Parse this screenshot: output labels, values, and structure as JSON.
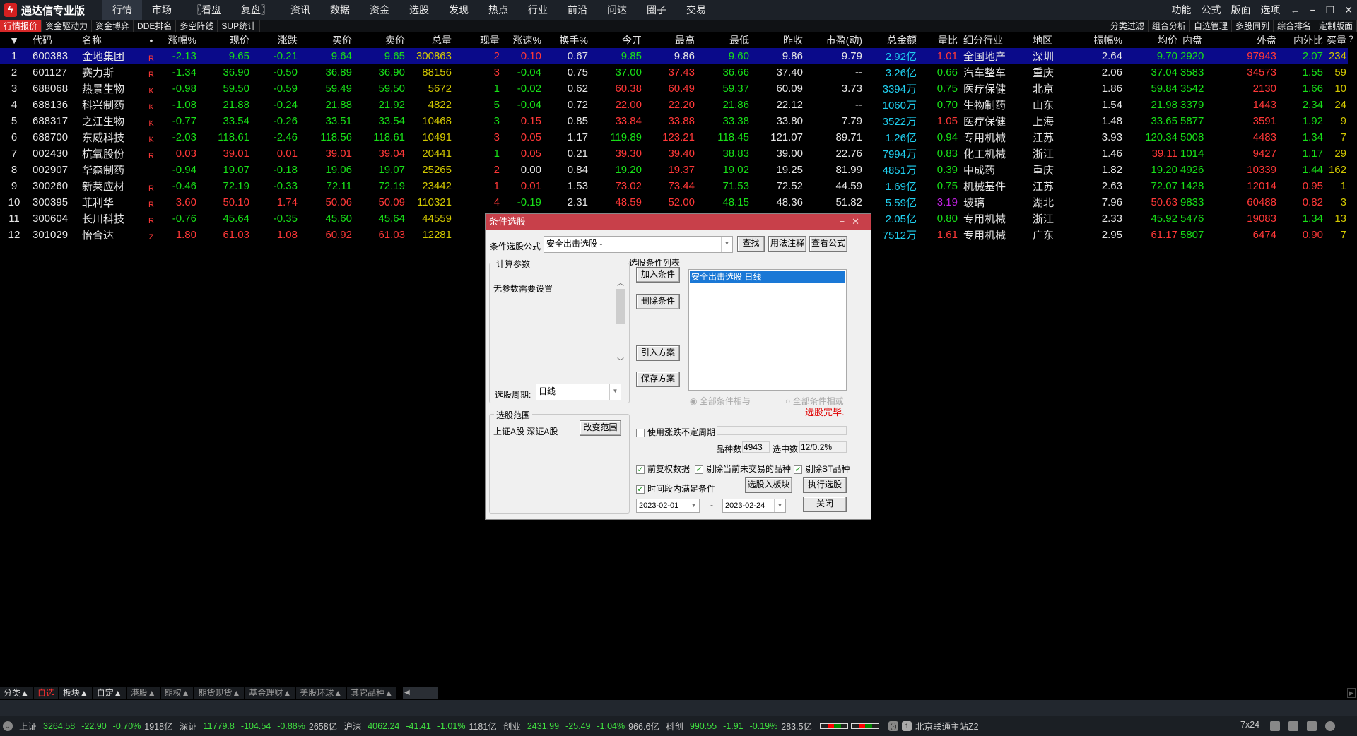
{
  "app": {
    "title": "通达信专业版"
  },
  "menu": [
    "行情",
    "市场",
    "〖看盘",
    "复盘〗",
    "资讯",
    "数据",
    "资金",
    "选股",
    "发现",
    "热点",
    "行业",
    "前沿",
    "问达",
    "圈子",
    "交易"
  ],
  "topright": [
    "功能",
    "公式",
    "版面",
    "选项"
  ],
  "subtabs": [
    "行情报价",
    "资金驱动力",
    "资金博弈",
    "DDE排名",
    "多空阵线",
    "SUP统计"
  ],
  "subtabs_right": [
    "分类过滤",
    "组合分析",
    "自选管理",
    "多股同列",
    "综合排名",
    "定制版面"
  ],
  "headers": [
    "▼",
    "代码",
    "名称",
    "•",
    "涨幅%",
    "现价",
    "涨跌",
    "买价",
    "卖价",
    "总量",
    "现量",
    "涨速%",
    "换手%",
    "今开",
    "最高",
    "最低",
    "昨收",
    "市盈(动)",
    "总金额",
    "量比",
    "细分行业",
    "地区",
    "振幅%",
    "均价",
    "内盘",
    "外盘",
    "内外比",
    "买量",
    "?"
  ],
  "rows": [
    {
      "v": [
        "1",
        "600383",
        "金地集团",
        "R",
        "-2.13",
        "9.65",
        "-0.21",
        "9.64",
        "9.65",
        "300863",
        "2",
        "0.10",
        "0.67",
        "9.85",
        "9.86",
        "9.60",
        "9.86",
        "9.79",
        "2.92亿",
        "1.01",
        "全国地产",
        "深圳",
        "2.64",
        "9.70",
        "2920",
        "97943",
        "2.07",
        "234"
      ],
      "c": "wwwrgggggyrrwgwgwwcrwwwggrgy"
    },
    {
      "v": [
        "2",
        "601127",
        "赛力斯",
        "R",
        "-1.34",
        "36.90",
        "-0.50",
        "36.89",
        "36.90",
        "88156",
        "3",
        "-0.04",
        "0.75",
        "37.00",
        "37.43",
        "36.66",
        "37.40",
        "--",
        "3.26亿",
        "0.66",
        "汽车整车",
        "重庆",
        "2.06",
        "37.04",
        "3583",
        "34573",
        "1.55",
        "59"
      ],
      "c": "wwwrgggggyrgwgrgwwcgwwwggrgy"
    },
    {
      "v": [
        "3",
        "688068",
        "热景生物",
        "K",
        "-0.98",
        "59.50",
        "-0.59",
        "59.49",
        "59.50",
        "5672",
        "1",
        "-0.02",
        "0.62",
        "60.38",
        "60.49",
        "59.37",
        "60.09",
        "3.73",
        "3394万",
        "0.75",
        "医疗保健",
        "北京",
        "1.86",
        "59.84",
        "3542",
        "2130",
        "1.66",
        "10"
      ],
      "c": "wwwrgggggyggwrrgwwcgwwwggrgy"
    },
    {
      "v": [
        "4",
        "688136",
        "科兴制药",
        "K",
        "-1.08",
        "21.88",
        "-0.24",
        "21.88",
        "21.92",
        "4822",
        "5",
        "-0.04",
        "0.72",
        "22.00",
        "22.20",
        "21.86",
        "22.12",
        "--",
        "1060万",
        "0.70",
        "生物制药",
        "山东",
        "1.54",
        "21.98",
        "3379",
        "1443",
        "2.34",
        "24"
      ],
      "c": "wwwrgggggyggwrrgwwcgwwwggrgy"
    },
    {
      "v": [
        "5",
        "688317",
        "之江生物",
        "K",
        "-0.77",
        "33.54",
        "-0.26",
        "33.51",
        "33.54",
        "10468",
        "3",
        "0.15",
        "0.85",
        "33.84",
        "33.88",
        "33.38",
        "33.80",
        "7.79",
        "3522万",
        "1.05",
        "医疗保健",
        "上海",
        "1.48",
        "33.65",
        "5877",
        "3591",
        "1.92",
        "9"
      ],
      "c": "wwwrgggggygrwrrgwwcrwwwggrgy"
    },
    {
      "v": [
        "6",
        "688700",
        "东威科技",
        "K",
        "-2.03",
        "118.61",
        "-2.46",
        "118.56",
        "118.61",
        "10491",
        "3",
        "0.05",
        "1.17",
        "119.89",
        "123.21",
        "118.45",
        "121.07",
        "89.71",
        "1.26亿",
        "0.94",
        "专用机械",
        "江苏",
        "3.93",
        "120.34",
        "5008",
        "4483",
        "1.34",
        "7"
      ],
      "c": "wwwrgggggyrrwgrgwwcgwwwggrgy"
    },
    {
      "v": [
        "7",
        "002430",
        "杭氧股份",
        "R",
        "0.03",
        "39.01",
        "0.01",
        "39.01",
        "39.04",
        "20441",
        "1",
        "0.05",
        "0.21",
        "39.30",
        "39.40",
        "38.83",
        "39.00",
        "22.76",
        "7994万",
        "0.83",
        "化工机械",
        "浙江",
        "1.46",
        "39.11",
        "1014",
        "9427",
        "1.17",
        "29"
      ],
      "c": "wwwrrrrrrygrwrrgwwcgwwwrgrgy"
    },
    {
      "v": [
        "8",
        "002907",
        "华森制药",
        "",
        "-0.94",
        "19.07",
        "-0.18",
        "19.06",
        "19.07",
        "25265",
        "2",
        "0.00",
        "0.84",
        "19.20",
        "19.37",
        "19.02",
        "19.25",
        "81.99",
        "4851万",
        "0.39",
        "中成药",
        "重庆",
        "1.82",
        "19.20",
        "4926",
        "10339",
        "1.44",
        "162"
      ],
      "c": "wwwrgggggyrwwgrgwwcgwwwggrgy"
    },
    {
      "v": [
        "9",
        "300260",
        "新莱应材",
        "R",
        "-0.46",
        "72.19",
        "-0.33",
        "72.11",
        "72.19",
        "23442",
        "1",
        "0.01",
        "1.53",
        "73.02",
        "73.44",
        "71.53",
        "72.52",
        "44.59",
        "1.69亿",
        "0.75",
        "机械基件",
        "江苏",
        "2.63",
        "72.07",
        "1428",
        "12014",
        "0.95",
        "1"
      ],
      "c": "wwwrgggggyrrwrrgwwcgwwwggrry"
    },
    {
      "v": [
        "10",
        "300395",
        "菲利华",
        "R",
        "3.60",
        "50.10",
        "1.74",
        "50.06",
        "50.09",
        "110321",
        "4",
        "-0.19",
        "2.31",
        "48.59",
        "52.00",
        "48.15",
        "48.36",
        "51.82",
        "5.59亿",
        "3.19",
        "玻璃",
        "湖北",
        "7.96",
        "50.63",
        "9833",
        "60488",
        "0.82",
        "3"
      ],
      "c": "wwwrrrrrryrgwrrgwwcpwwwrgrry"
    },
    {
      "v": [
        "11",
        "300604",
        "长川科技",
        "R",
        "-0.76",
        "45.64",
        "-0.35",
        "45.60",
        "45.64",
        "44559",
        null,
        null,
        null,
        null,
        null,
        null,
        null,
        null,
        "2.05亿",
        "0.80",
        "专用机械",
        "浙江",
        "2.33",
        "45.92",
        "5476",
        "19083",
        "1.34",
        "13"
      ],
      "c": "wwwrgggggywwwwwwwwcgwwwggrgy"
    },
    {
      "v": [
        "12",
        "301029",
        "怡合达",
        "Z",
        "1.80",
        "61.03",
        "1.08",
        "60.92",
        "61.03",
        "12281",
        null,
        null,
        null,
        null,
        null,
        null,
        null,
        null,
        "7512万",
        "1.61",
        "专用机械",
        "广东",
        "2.95",
        "61.17",
        "5807",
        "6474",
        "0.90",
        "7"
      ],
      "c": "wwwrrrrrrywwwwwwwwcrwwwrgrry"
    }
  ],
  "colors": {
    "w": "#e6e6e6",
    "g": "#18e018",
    "r": "#ff3838",
    "y": "#d2c800",
    "c": "#20d0f0",
    "p": "#c020e0",
    "selected_row": "#0a0a8a",
    "dialog_title": "#c8404a"
  },
  "dialog": {
    "title": "条件选股",
    "formula_label": "条件选股公式",
    "formula_value": "安全出击选股 -",
    "find": "查找",
    "usage": "用法注释",
    "view_formula": "查看公式",
    "params_group": "计算参数",
    "params_text": "无参数需要设置",
    "period_label": "选股周期:",
    "period_value": "日线",
    "add_cond": "加入条件",
    "del_cond": "删除条件",
    "import_plan": "引入方案",
    "save_plan": "保存方案",
    "cond_list_label": "选股条件列表",
    "cond_items": [
      "安全出击选股  日线"
    ],
    "radio_and": "全部条件相与",
    "radio_or": "全部条件相或",
    "status": "选股完毕.",
    "range_group": "选股范围",
    "range_text": "上证A股 深证A股",
    "change_range": "改变范围",
    "use_period": "使用涨跌不定周期",
    "count_label": "品种数",
    "count_value": "4943",
    "selected_label": "选中数",
    "selected_value": "12/0.2%",
    "opt1": "前复权数据",
    "opt2": "剔除当前未交易的品种",
    "opt3": "剔除ST品种",
    "time_cond": "时间段内满足条件",
    "to_block": "选股入板块",
    "execute": "执行选股",
    "date_from": "2023-02-01",
    "dash": "-",
    "date_to": "2023-02-24",
    "close": "关闭"
  },
  "bottomtabs": [
    {
      "l": "分类▲",
      "s": ""
    },
    {
      "l": "自选",
      "s": "red"
    },
    {
      "l": "板块▲",
      "s": ""
    },
    {
      "l": "自定▲",
      "s": ""
    },
    {
      "l": "港股▲",
      "s": "dim"
    },
    {
      "l": "期权▲",
      "s": "dim"
    },
    {
      "l": "期货现货▲",
      "s": "dim"
    },
    {
      "l": "基金理财▲",
      "s": "dim"
    },
    {
      "l": "美股环球▲",
      "s": "dim"
    },
    {
      "l": "其它品种▲",
      "s": "dim"
    }
  ],
  "status": {
    "indices": [
      {
        "name": "上证",
        "v": [
          "3264.58",
          "-22.90",
          "-0.70%"
        ],
        "amt": "1918亿"
      },
      {
        "name": "深证",
        "v": [
          "11779.8",
          "-104.54",
          "-0.88%"
        ],
        "amt": "2658亿"
      },
      {
        "name": "沪深",
        "v": [
          "4062.24",
          "-41.41",
          "-1.01%"
        ],
        "amt": "1181亿"
      },
      {
        "name": "创业",
        "v": [
          "2431.99",
          "-25.49",
          "-1.04%"
        ],
        "amt": "966.6亿"
      },
      {
        "name": "科创",
        "v": [
          "990.55",
          "-1.91",
          "-0.19%"
        ],
        "amt": "283.5亿"
      }
    ],
    "server": "北京联通主站Z2",
    "server_num": "1",
    "service": "7x24"
  }
}
